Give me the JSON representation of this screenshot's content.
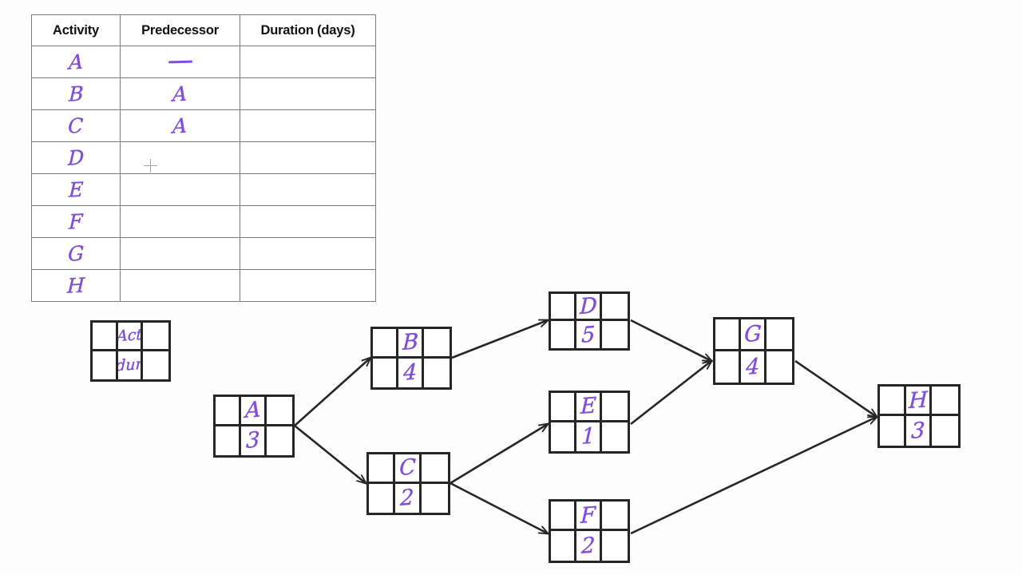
{
  "table": {
    "headers": [
      "Activity",
      "Predecessor",
      "Duration (days)"
    ],
    "rows": [
      {
        "activity": "A",
        "predecessor": "—",
        "duration": ""
      },
      {
        "activity": "B",
        "predecessor": "A",
        "duration": ""
      },
      {
        "activity": "C",
        "predecessor": "A",
        "duration": ""
      },
      {
        "activity": "D",
        "predecessor": "",
        "duration": ""
      },
      {
        "activity": "E",
        "predecessor": "",
        "duration": ""
      },
      {
        "activity": "F",
        "predecessor": "",
        "duration": ""
      },
      {
        "activity": "G",
        "predecessor": "",
        "duration": ""
      },
      {
        "activity": "H",
        "predecessor": "",
        "duration": ""
      }
    ]
  },
  "legend": {
    "activity_label": "Act",
    "duration_label": "dur"
  },
  "nodes": [
    {
      "id": "A",
      "activity": "A",
      "duration": "3"
    },
    {
      "id": "B",
      "activity": "B",
      "duration": "4"
    },
    {
      "id": "C",
      "activity": "C",
      "duration": "2"
    },
    {
      "id": "D",
      "activity": "D",
      "duration": "5"
    },
    {
      "id": "E",
      "activity": "E",
      "duration": "1"
    },
    {
      "id": "F",
      "activity": "F",
      "duration": "2"
    },
    {
      "id": "G",
      "activity": "G",
      "duration": "4"
    },
    {
      "id": "H",
      "activity": "H",
      "duration": "3"
    }
  ],
  "edges": [
    {
      "from": "A",
      "to": "B"
    },
    {
      "from": "A",
      "to": "C"
    },
    {
      "from": "B",
      "to": "D"
    },
    {
      "from": "C",
      "to": "E"
    },
    {
      "from": "C",
      "to": "F"
    },
    {
      "from": "D",
      "to": "G"
    },
    {
      "from": "E",
      "to": "G"
    },
    {
      "from": "G",
      "to": "H"
    },
    {
      "from": "F",
      "to": "H"
    }
  ],
  "colors": {
    "ink": "#8150d8",
    "line": "#262626",
    "table_border": "#7a7a7a",
    "background": "#fdfdfd"
  }
}
